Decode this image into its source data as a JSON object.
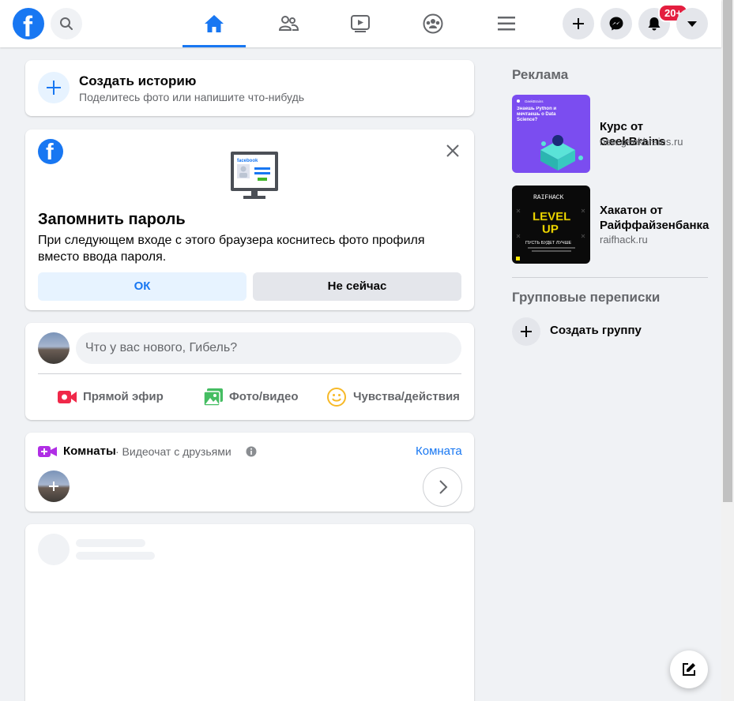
{
  "topbar": {
    "logo_letter": "f",
    "notifications_badge": "20+"
  },
  "story": {
    "title": "Создать историю",
    "subtitle": "Поделитесь фото или напишите что-нибудь"
  },
  "password_prompt": {
    "logo_letter": "f",
    "illustration_text": "facebook",
    "title": "Запомнить пароль",
    "text": "При следующем входе с этого браузера коснитесь фото профиля вместо ввода пароля.",
    "ok_label": "ОК",
    "not_now_label": "Не сейчас"
  },
  "composer": {
    "placeholder": "Что у вас нового, Гибель?",
    "actions": [
      {
        "label": "Прямой эфир",
        "color": "#f02849"
      },
      {
        "label": "Фото/видео",
        "color": "#45bd62"
      },
      {
        "label": "Чувства/действия",
        "color": "#f7b928"
      }
    ]
  },
  "rooms": {
    "title": "Комнаты",
    "subtitle": "· Видеочат с друзьями",
    "link": "Комната"
  },
  "sidebar": {
    "ads_heading": "Реклама",
    "ads": [
      {
        "title": "Курс от GeekBrains",
        "url": "new.geekbrains.ru",
        "image_brand": "GeekBrains",
        "image_text": "Знаешь Python и мечтаешь о Data Science?"
      },
      {
        "title": "Хакатон от Райффайзенбанка",
        "url": "raifhack.ru",
        "image_brand": "RAIFHACK",
        "image_line1": "LEVEL",
        "image_line2": "UP",
        "image_text": "ПУСТЬ БУДЕТ ЛУЧШЕ"
      }
    ],
    "groups_heading": "Групповые переписки",
    "create_group": "Создать группу"
  },
  "colors": {
    "accent": "#1877f2",
    "background": "#f0f2f5",
    "badge": "#e41e3f"
  }
}
